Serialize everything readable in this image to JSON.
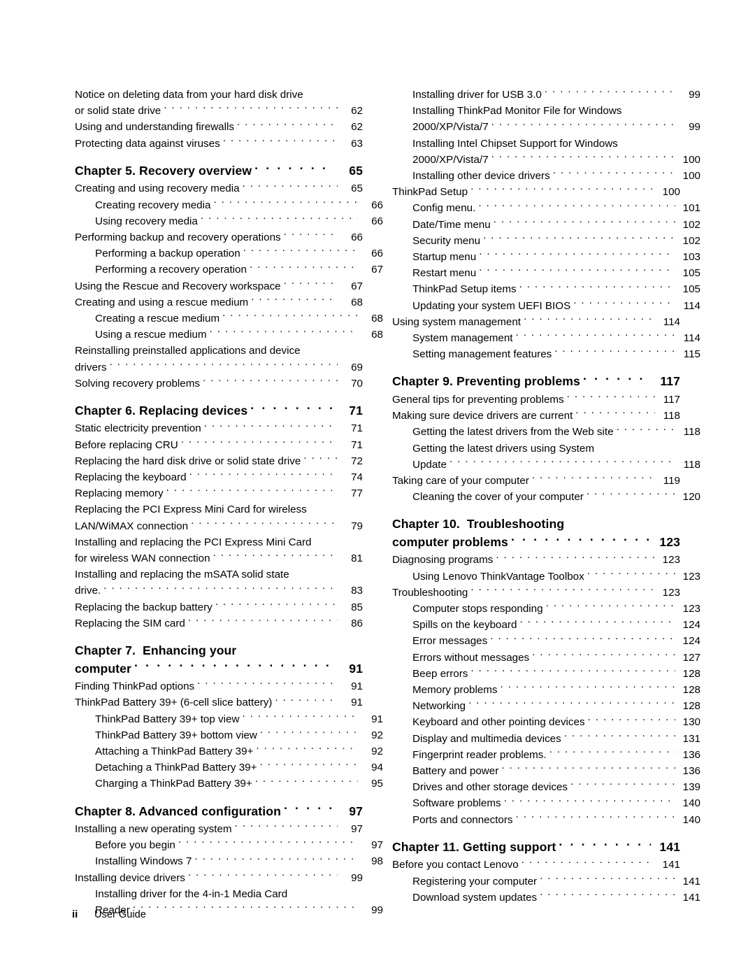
{
  "document": {
    "type": "table-of-contents",
    "footer": {
      "folio": "ii",
      "label": "User Guide"
    }
  },
  "columns": [
    {
      "name": "left-column",
      "entries": [
        {
          "level": 1,
          "kind": "entry",
          "lines": [
            "Notice on deleting data from your hard disk drive",
            "or solid state drive"
          ],
          "label": "Notice on deleting data from your hard disk drive or solid state drive",
          "page": "62"
        },
        {
          "level": 1,
          "kind": "entry",
          "lines": [
            "Using and understanding firewalls"
          ],
          "label": "Using and understanding firewalls",
          "page": "62"
        },
        {
          "level": 1,
          "kind": "entry",
          "lines": [
            "Protecting data against viruses"
          ],
          "label": "Protecting data against viruses",
          "page": "63"
        },
        {
          "level": 1,
          "kind": "chapter",
          "lines": [
            "Chapter 5. Recovery overview"
          ],
          "label": "Chapter 5. Recovery overview",
          "page": "65"
        },
        {
          "level": 1,
          "kind": "entry",
          "lines": [
            "Creating and using recovery media"
          ],
          "label": "Creating and using recovery media",
          "page": "65"
        },
        {
          "level": 2,
          "kind": "entry",
          "lines": [
            "Creating recovery media"
          ],
          "label": "Creating recovery media",
          "page": "66"
        },
        {
          "level": 2,
          "kind": "entry",
          "lines": [
            "Using recovery media"
          ],
          "label": "Using recovery media",
          "page": "66"
        },
        {
          "level": 1,
          "kind": "entry",
          "lines": [
            "Performing backup and recovery operations"
          ],
          "label": "Performing backup and recovery operations",
          "page": "66"
        },
        {
          "level": 2,
          "kind": "entry",
          "lines": [
            "Performing a backup operation"
          ],
          "label": "Performing a backup operation",
          "page": "66"
        },
        {
          "level": 2,
          "kind": "entry",
          "lines": [
            "Performing a recovery operation"
          ],
          "label": "Performing a recovery operation",
          "page": "67"
        },
        {
          "level": 1,
          "kind": "entry",
          "lines": [
            "Using the Rescue and Recovery workspace"
          ],
          "label": "Using the Rescue and Recovery workspace",
          "page": "67"
        },
        {
          "level": 1,
          "kind": "entry",
          "lines": [
            "Creating and using a rescue medium"
          ],
          "label": "Creating and using a rescue medium",
          "page": "68"
        },
        {
          "level": 2,
          "kind": "entry",
          "lines": [
            "Creating a rescue medium"
          ],
          "label": "Creating a rescue medium",
          "page": "68"
        },
        {
          "level": 2,
          "kind": "entry",
          "lines": [
            "Using a rescue medium"
          ],
          "label": "Using a rescue medium",
          "page": "68"
        },
        {
          "level": 1,
          "kind": "entry",
          "lines": [
            "Reinstalling preinstalled applications and device",
            "drivers"
          ],
          "label": "Reinstalling preinstalled applications and device drivers",
          "page": "69"
        },
        {
          "level": 1,
          "kind": "entry",
          "lines": [
            "Solving recovery problems"
          ],
          "label": "Solving recovery problems",
          "page": "70"
        },
        {
          "level": 1,
          "kind": "chapter",
          "lines": [
            "Chapter 6. Replacing devices"
          ],
          "label": "Chapter 6. Replacing devices",
          "page": "71"
        },
        {
          "level": 1,
          "kind": "entry",
          "lines": [
            "Static electricity prevention"
          ],
          "label": "Static electricity prevention",
          "page": "71"
        },
        {
          "level": 1,
          "kind": "entry",
          "lines": [
            "Before replacing CRU"
          ],
          "label": "Before replacing CRU",
          "page": "71"
        },
        {
          "level": 1,
          "kind": "entry",
          "lines": [
            "Replacing the hard disk drive or solid state drive"
          ],
          "label": "Replacing the hard disk drive or solid state drive",
          "page": "72"
        },
        {
          "level": 1,
          "kind": "entry",
          "lines": [
            "Replacing the keyboard"
          ],
          "label": "Replacing the keyboard",
          "page": "74"
        },
        {
          "level": 1,
          "kind": "entry",
          "lines": [
            "Replacing memory"
          ],
          "label": "Replacing memory",
          "page": "77"
        },
        {
          "level": 1,
          "kind": "entry",
          "lines": [
            "Replacing the PCI Express Mini Card for wireless",
            "LAN/WiMAX connection"
          ],
          "label": "Replacing the PCI Express Mini Card for wireless LAN/WiMAX connection",
          "page": "79"
        },
        {
          "level": 1,
          "kind": "entry",
          "lines": [
            "Installing and replacing the PCI Express Mini Card",
            "for wireless WAN connection"
          ],
          "label": "Installing and replacing the PCI Express Mini Card for wireless WAN connection",
          "page": "81"
        },
        {
          "level": 1,
          "kind": "entry",
          "lines": [
            "Installing and replacing the mSATA solid state",
            "drive."
          ],
          "label": "Installing and replacing the mSATA solid state drive.",
          "page": "83"
        },
        {
          "level": 1,
          "kind": "entry",
          "lines": [
            "Replacing the backup battery"
          ],
          "label": "Replacing the backup battery",
          "page": "85"
        },
        {
          "level": 1,
          "kind": "entry",
          "lines": [
            "Replacing the SIM card"
          ],
          "label": "Replacing the SIM card",
          "page": "86"
        },
        {
          "level": 1,
          "kind": "chapter",
          "lines": [
            "Chapter 7.  Enhancing your",
            "computer"
          ],
          "label": "Chapter 7.  Enhancing your computer",
          "page": "91"
        },
        {
          "level": 1,
          "kind": "entry",
          "lines": [
            "Finding ThinkPad options"
          ],
          "label": "Finding ThinkPad options",
          "page": "91"
        },
        {
          "level": 1,
          "kind": "entry",
          "lines": [
            "ThinkPad Battery 39+ (6-cell slice battery)"
          ],
          "label": "ThinkPad Battery 39+ (6-cell slice battery)",
          "page": "91"
        },
        {
          "level": 2,
          "kind": "entry",
          "lines": [
            "ThinkPad Battery 39+ top view"
          ],
          "label": "ThinkPad Battery 39+ top view",
          "page": "91"
        },
        {
          "level": 2,
          "kind": "entry",
          "lines": [
            "ThinkPad Battery 39+ bottom view"
          ],
          "label": "ThinkPad Battery 39+ bottom view",
          "page": "92"
        },
        {
          "level": 2,
          "kind": "entry",
          "lines": [
            "Attaching a ThinkPad Battery 39+"
          ],
          "label": "Attaching a ThinkPad Battery 39+",
          "page": "92"
        },
        {
          "level": 2,
          "kind": "entry",
          "lines": [
            "Detaching a ThinkPad Battery 39+"
          ],
          "label": "Detaching a ThinkPad Battery 39+",
          "page": "94"
        },
        {
          "level": 2,
          "kind": "entry",
          "lines": [
            "Charging a ThinkPad Battery 39+"
          ],
          "label": "Charging a ThinkPad Battery 39+",
          "page": "95"
        },
        {
          "level": 1,
          "kind": "chapter",
          "lines": [
            "Chapter 8. Advanced configuration"
          ],
          "label": "Chapter 8. Advanced configuration",
          "page": "97"
        },
        {
          "level": 1,
          "kind": "entry",
          "lines": [
            "Installing a new operating system"
          ],
          "label": "Installing a new operating system",
          "page": "97"
        },
        {
          "level": 2,
          "kind": "entry",
          "lines": [
            "Before you begin"
          ],
          "label": "Before you begin",
          "page": "97"
        },
        {
          "level": 2,
          "kind": "entry",
          "lines": [
            "Installing Windows 7"
          ],
          "label": "Installing Windows 7",
          "page": "98"
        },
        {
          "level": 1,
          "kind": "entry",
          "lines": [
            "Installing device drivers"
          ],
          "label": "Installing device drivers",
          "page": "99"
        },
        {
          "level": 2,
          "kind": "entry",
          "lines": [
            "Installing driver for the 4-in-1 Media Card",
            "Reader"
          ],
          "label": "Installing driver for the 4-in-1 Media Card Reader",
          "page": "99"
        }
      ]
    },
    {
      "name": "right-column",
      "entries": [
        {
          "level": 2,
          "kind": "entry",
          "lines": [
            "Installing driver for USB 3.0"
          ],
          "label": "Installing driver for USB 3.0",
          "page": "99"
        },
        {
          "level": 2,
          "kind": "entry",
          "lines": [
            "Installing ThinkPad Monitor File for Windows",
            "2000/XP/Vista/7"
          ],
          "label": "Installing ThinkPad Monitor File for Windows 2000/XP/Vista/7",
          "page": "99"
        },
        {
          "level": 2,
          "kind": "entry",
          "lines": [
            "Installing Intel Chipset Support for Windows",
            "2000/XP/Vista/7"
          ],
          "label": "Installing Intel Chipset Support for Windows 2000/XP/Vista/7",
          "page": "100"
        },
        {
          "level": 2,
          "kind": "entry",
          "lines": [
            "Installing other device drivers"
          ],
          "label": "Installing other device drivers",
          "page": "100"
        },
        {
          "level": 1,
          "kind": "entry",
          "lines": [
            "ThinkPad Setup"
          ],
          "label": "ThinkPad Setup",
          "page": "100"
        },
        {
          "level": 2,
          "kind": "entry",
          "lines": [
            "Config menu."
          ],
          "label": "Config menu.",
          "page": "101"
        },
        {
          "level": 2,
          "kind": "entry",
          "lines": [
            "Date/Time menu"
          ],
          "label": "Date/Time menu",
          "page": "102"
        },
        {
          "level": 2,
          "kind": "entry",
          "lines": [
            "Security menu"
          ],
          "label": "Security menu",
          "page": "102"
        },
        {
          "level": 2,
          "kind": "entry",
          "lines": [
            "Startup menu"
          ],
          "label": "Startup menu",
          "page": "103"
        },
        {
          "level": 2,
          "kind": "entry",
          "lines": [
            "Restart menu"
          ],
          "label": "Restart menu",
          "page": "105"
        },
        {
          "level": 2,
          "kind": "entry",
          "lines": [
            "ThinkPad Setup items"
          ],
          "label": "ThinkPad Setup items",
          "page": "105"
        },
        {
          "level": 2,
          "kind": "entry",
          "lines": [
            "Updating your system UEFI BIOS"
          ],
          "label": "Updating your system UEFI BIOS",
          "page": "114"
        },
        {
          "level": 1,
          "kind": "entry",
          "lines": [
            "Using system management"
          ],
          "label": "Using system management",
          "page": "114"
        },
        {
          "level": 2,
          "kind": "entry",
          "lines": [
            "System management"
          ],
          "label": "System management",
          "page": "114"
        },
        {
          "level": 2,
          "kind": "entry",
          "lines": [
            "Setting management features"
          ],
          "label": "Setting management features",
          "page": "115"
        },
        {
          "level": 1,
          "kind": "chapter",
          "lines": [
            "Chapter 9. Preventing problems"
          ],
          "label": "Chapter 9. Preventing problems",
          "page": "117"
        },
        {
          "level": 1,
          "kind": "entry",
          "lines": [
            "General tips for preventing problems"
          ],
          "label": "General tips for preventing problems",
          "page": "117"
        },
        {
          "level": 1,
          "kind": "entry",
          "lines": [
            "Making sure device drivers are current"
          ],
          "label": "Making sure device drivers are current",
          "page": "118"
        },
        {
          "level": 2,
          "kind": "entry",
          "lines": [
            "Getting the latest drivers from the Web site"
          ],
          "label": "Getting the latest drivers from the Web site",
          "page": "118"
        },
        {
          "level": 2,
          "kind": "entry",
          "lines": [
            "Getting the latest drivers using System",
            "Update"
          ],
          "label": "Getting the latest drivers using System Update",
          "page": "118"
        },
        {
          "level": 1,
          "kind": "entry",
          "lines": [
            "Taking care of your computer"
          ],
          "label": "Taking care of your computer",
          "page": "119"
        },
        {
          "level": 2,
          "kind": "entry",
          "lines": [
            "Cleaning the cover of your computer"
          ],
          "label": "Cleaning the cover of your computer",
          "page": "120"
        },
        {
          "level": 1,
          "kind": "chapter",
          "lines": [
            "Chapter 10.  Troubleshooting",
            "computer problems"
          ],
          "label": "Chapter 10.  Troubleshooting computer problems",
          "page": "123"
        },
        {
          "level": 1,
          "kind": "entry",
          "lines": [
            "Diagnosing programs"
          ],
          "label": "Diagnosing programs",
          "page": "123"
        },
        {
          "level": 2,
          "kind": "entry",
          "lines": [
            "Using Lenovo ThinkVantage Toolbox"
          ],
          "label": "Using Lenovo ThinkVantage Toolbox",
          "page": "123"
        },
        {
          "level": 1,
          "kind": "entry",
          "lines": [
            "Troubleshooting"
          ],
          "label": "Troubleshooting",
          "page": "123"
        },
        {
          "level": 2,
          "kind": "entry",
          "lines": [
            "Computer stops responding"
          ],
          "label": "Computer stops responding",
          "page": "123"
        },
        {
          "level": 2,
          "kind": "entry",
          "lines": [
            "Spills on the keyboard"
          ],
          "label": "Spills on the keyboard",
          "page": "124"
        },
        {
          "level": 2,
          "kind": "entry",
          "lines": [
            "Error messages"
          ],
          "label": "Error messages",
          "page": "124"
        },
        {
          "level": 2,
          "kind": "entry",
          "lines": [
            "Errors without messages"
          ],
          "label": "Errors without messages",
          "page": "127"
        },
        {
          "level": 2,
          "kind": "entry",
          "lines": [
            "Beep errors"
          ],
          "label": "Beep errors",
          "page": "128"
        },
        {
          "level": 2,
          "kind": "entry",
          "lines": [
            "Memory problems"
          ],
          "label": "Memory problems",
          "page": "128"
        },
        {
          "level": 2,
          "kind": "entry",
          "lines": [
            "Networking"
          ],
          "label": "Networking",
          "page": "128"
        },
        {
          "level": 2,
          "kind": "entry",
          "lines": [
            "Keyboard and other pointing devices"
          ],
          "label": "Keyboard and other pointing devices",
          "page": "130"
        },
        {
          "level": 2,
          "kind": "entry",
          "lines": [
            "Display and multimedia devices"
          ],
          "label": "Display and multimedia devices",
          "page": "131"
        },
        {
          "level": 2,
          "kind": "entry",
          "lines": [
            "Fingerprint reader problems."
          ],
          "label": "Fingerprint reader problems.",
          "page": "136"
        },
        {
          "level": 2,
          "kind": "entry",
          "lines": [
            "Battery and power"
          ],
          "label": "Battery and power",
          "page": "136"
        },
        {
          "level": 2,
          "kind": "entry",
          "lines": [
            "Drives and other storage devices"
          ],
          "label": "Drives and other storage devices",
          "page": "139"
        },
        {
          "level": 2,
          "kind": "entry",
          "lines": [
            "Software problems"
          ],
          "label": "Software problems",
          "page": "140"
        },
        {
          "level": 2,
          "kind": "entry",
          "lines": [
            "Ports and connectors"
          ],
          "label": "Ports and connectors",
          "page": "140"
        },
        {
          "level": 1,
          "kind": "chapter",
          "lines": [
            "Chapter 11. Getting support"
          ],
          "label": "Chapter 11. Getting support",
          "page": "141"
        },
        {
          "level": 1,
          "kind": "entry",
          "lines": [
            "Before you contact Lenovo"
          ],
          "label": "Before you contact Lenovo",
          "page": "141"
        },
        {
          "level": 2,
          "kind": "entry",
          "lines": [
            "Registering your computer"
          ],
          "label": "Registering your computer",
          "page": "141"
        },
        {
          "level": 2,
          "kind": "entry",
          "lines": [
            "Download system updates"
          ],
          "label": "Download system updates",
          "page": "141"
        }
      ]
    }
  ]
}
